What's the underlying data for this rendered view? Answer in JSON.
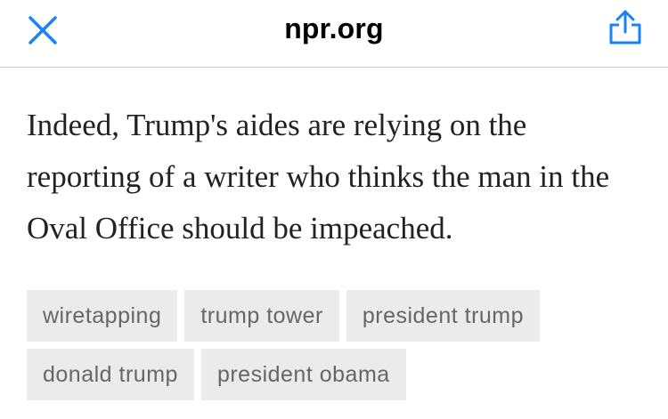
{
  "header": {
    "domain": "npr.org",
    "accent_color": "#1a82fb"
  },
  "article": {
    "text": "Indeed, Trump's aides are relying on the reporting of a writer who thinks the man in the Oval Office should be impeached."
  },
  "tags": {
    "row1": [
      "wiretapping",
      "trump tower",
      "president trump"
    ],
    "row2": [
      "donald trump",
      "president obama"
    ]
  },
  "icons": {
    "close": "close-icon",
    "share": "share-icon"
  }
}
